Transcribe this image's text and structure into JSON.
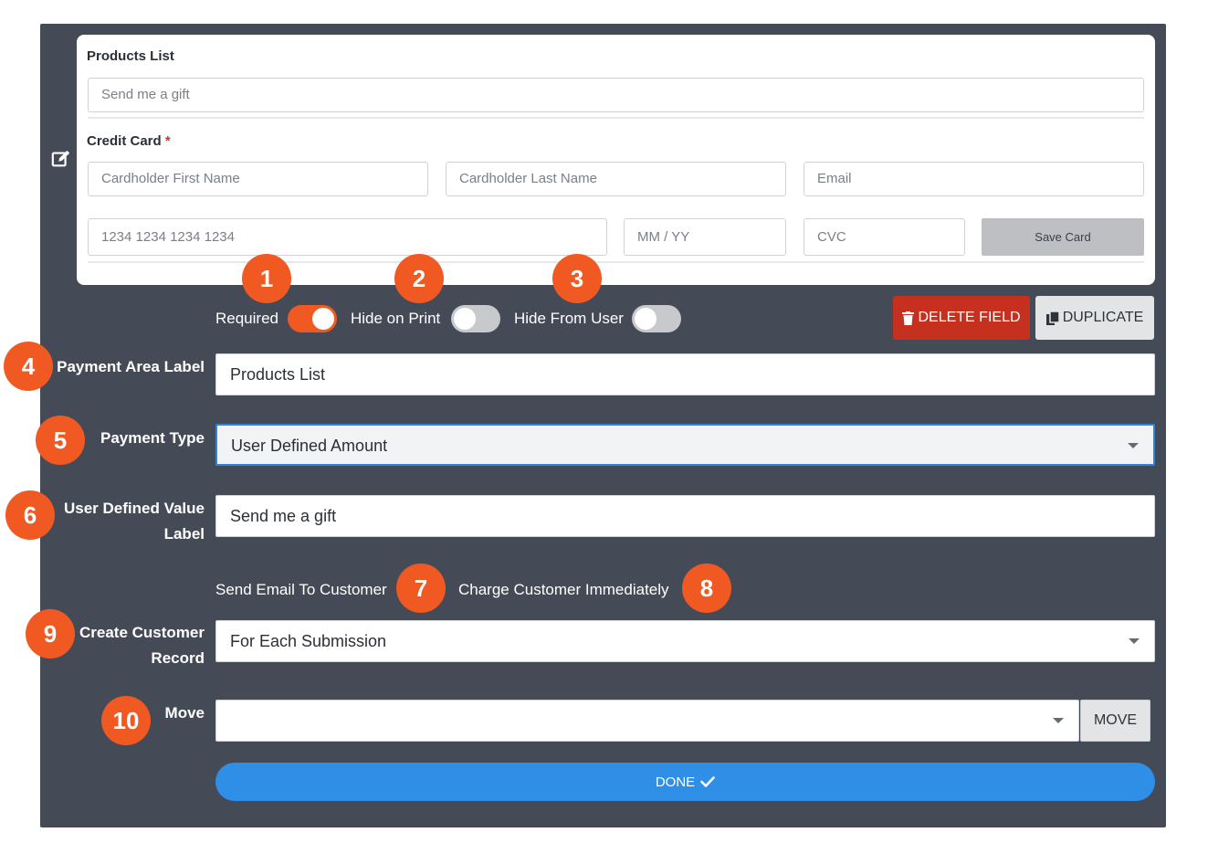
{
  "preview": {
    "products_label": "Products List",
    "products_placeholder": "Send me a gift",
    "credit_card_label": "Credit Card",
    "required_mark": "*",
    "first_name_placeholder": "Cardholder First Name",
    "last_name_placeholder": "Cardholder Last Name",
    "email_placeholder": "Email",
    "card_number_placeholder": "1234 1234 1234 1234",
    "expiry_placeholder": "MM / YY",
    "cvc_placeholder": "CVC",
    "save_card_label": "Save Card"
  },
  "toggles": {
    "required_label": "Required",
    "required_on": true,
    "hide_print_label": "Hide on Print",
    "hide_print_on": false,
    "hide_user_label": "Hide From User",
    "hide_user_on": false
  },
  "actions": {
    "delete_label": "DELETE FIELD",
    "duplicate_label": "DUPLICATE"
  },
  "fields": {
    "payment_area_label": "Payment Area Label",
    "payment_area_value": "Products List",
    "payment_type_label": "Payment Type",
    "payment_type_value": "User Defined Amount",
    "user_defined_label_line1": "User Defined Value",
    "user_defined_label_line2": "Label",
    "user_defined_value": "Send me a gift",
    "send_email_label": "Send Email To Customer",
    "charge_label": "Charge Customer Immediately",
    "create_record_line1": "Create Customer",
    "create_record_line2": "Record",
    "create_record_value": "For Each Submission",
    "move_label": "Move",
    "move_value": "",
    "move_button": "MOVE",
    "done_button": "DONE"
  },
  "badges": [
    "1",
    "2",
    "3",
    "4",
    "5",
    "6",
    "7",
    "8",
    "9",
    "10"
  ],
  "colors": {
    "panel": "#454b56",
    "accent": "#f05a22",
    "delete": "#c6301f",
    "primary": "#2f8fe6"
  },
  "icons": {
    "edit": "edit-icon",
    "trash": "trash-icon",
    "copy": "copy-icon",
    "check": "check-icon",
    "caret": "chevron-down-icon"
  }
}
